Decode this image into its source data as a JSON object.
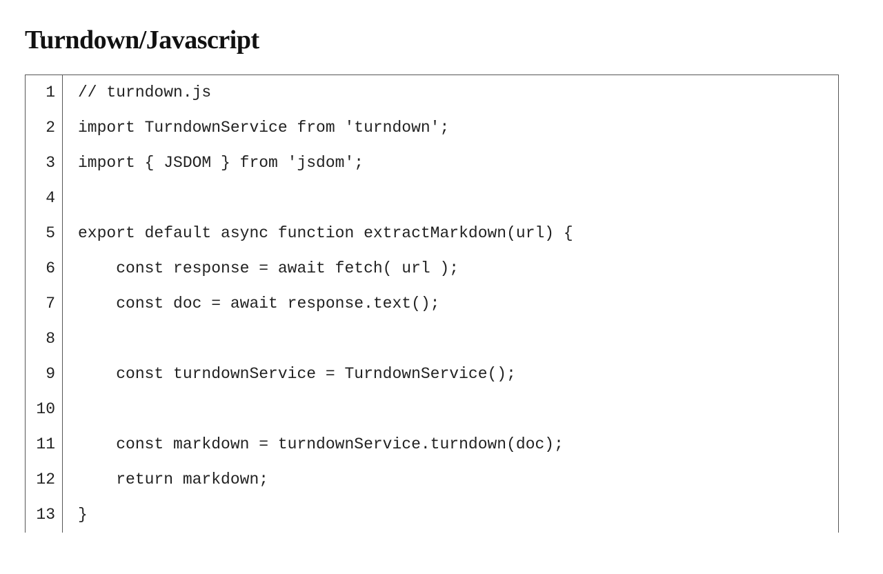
{
  "heading": "Turndown/Javascript",
  "code": {
    "language": "javascript",
    "lines": [
      {
        "n": "1",
        "text": "// turndown.js"
      },
      {
        "n": "2",
        "text": "import TurndownService from 'turndown';"
      },
      {
        "n": "3",
        "text": "import { JSDOM } from 'jsdom';"
      },
      {
        "n": "4",
        "text": ""
      },
      {
        "n": "5",
        "text": "export default async function extractMarkdown(url) {"
      },
      {
        "n": "6",
        "text": "    const response = await fetch( url );"
      },
      {
        "n": "7",
        "text": "    const doc = await response.text();"
      },
      {
        "n": "8",
        "text": ""
      },
      {
        "n": "9",
        "text": "    const turndownService = TurndownService();"
      },
      {
        "n": "10",
        "text": ""
      },
      {
        "n": "11",
        "text": "    const markdown = turndownService.turndown(doc);"
      },
      {
        "n": "12",
        "text": "    return markdown;"
      },
      {
        "n": "13",
        "text": "}"
      }
    ]
  }
}
